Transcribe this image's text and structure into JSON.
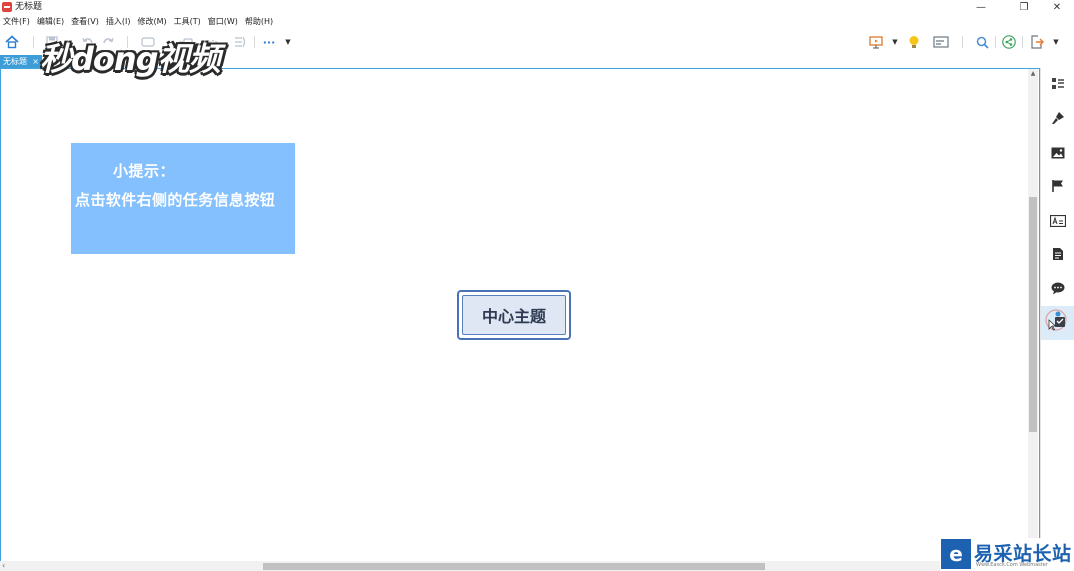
{
  "window": {
    "title": "无标题",
    "minimize_glyph": "—",
    "restore_glyph": "❐",
    "close_glyph": "✕"
  },
  "menu": [
    {
      "label": "文件(F)"
    },
    {
      "label": "编辑(E)"
    },
    {
      "label": "查看(V)"
    },
    {
      "label": "插入(I)"
    },
    {
      "label": "修改(M)"
    },
    {
      "label": "工具(T)"
    },
    {
      "label": "窗口(W)"
    },
    {
      "label": "帮助(H)"
    }
  ],
  "toolbar": {
    "more_glyph": "···",
    "icons": [
      "home-icon",
      "save-icon",
      "undo-icon",
      "redo-icon",
      "topic-icon",
      "subtopic-icon",
      "relationship-icon",
      "boundary-icon",
      "summary-icon",
      "more-icon",
      "presentation-icon",
      "idea-icon",
      "outliner-icon",
      "search-icon",
      "share-icon",
      "export-icon"
    ]
  },
  "tab": {
    "label": "无标题",
    "close_glyph": "×"
  },
  "canvas": {
    "tip_title": "小提示：",
    "tip_text": "点击软件右侧的任务信息按钮",
    "central_topic": "中心主题"
  },
  "right_panel": {
    "buttons": [
      "outline-icon",
      "format-brush-icon",
      "image-icon",
      "marker-flag-icon",
      "style-icon",
      "notes-icon",
      "comment-icon",
      "task-info-icon"
    ],
    "active": "task-info-icon"
  },
  "watermarks": {
    "video_brand": "秒dong视频",
    "site_name": "易采站长站",
    "site_url": "Www.Easck.Com Webmaster"
  },
  "colors": {
    "accent": "#3d9dd8",
    "tip_box": "#84c0fe",
    "central_border": "#4a72b6",
    "central_fill": "#dfe7f5",
    "site_brand": "#1d62b0"
  }
}
